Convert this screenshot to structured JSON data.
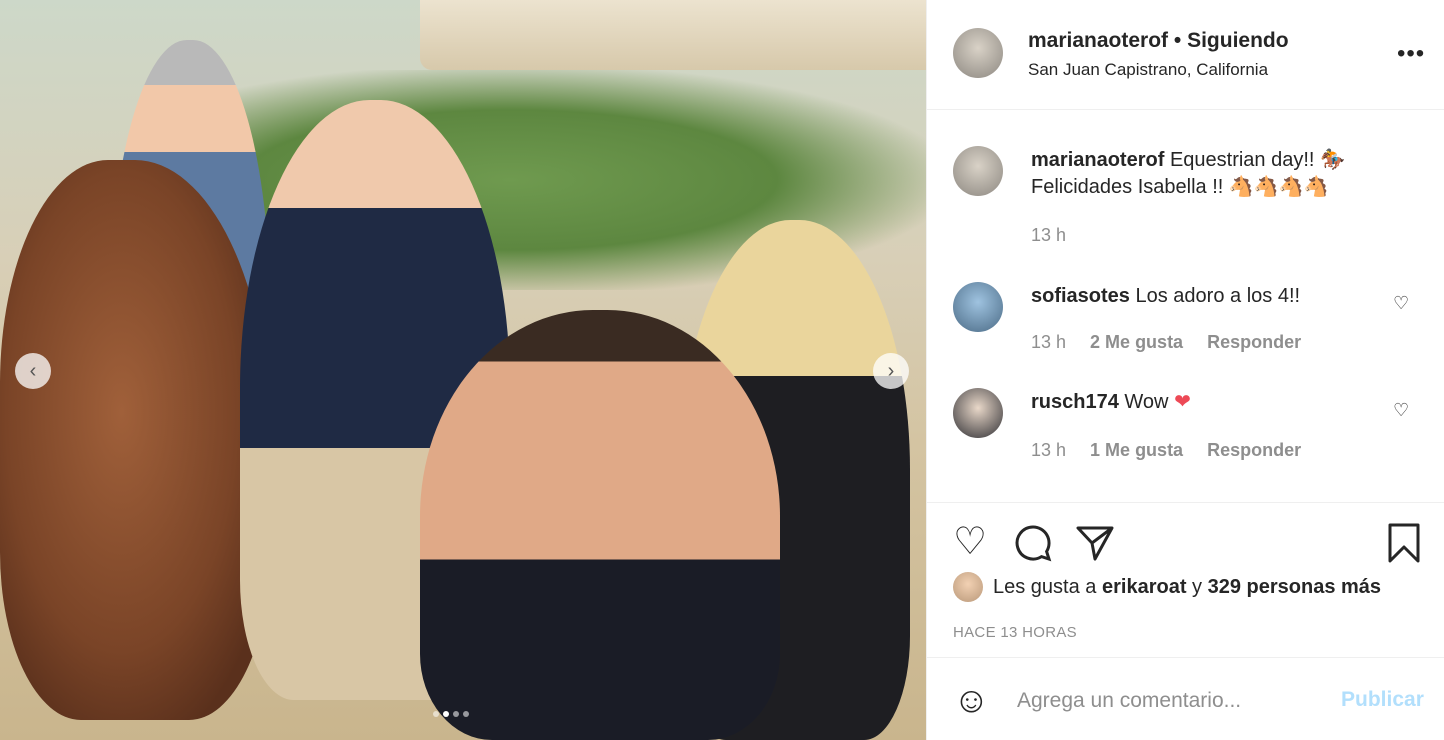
{
  "post": {
    "username": "marianaoterof",
    "separator": "•",
    "follow_status": "Siguiendo",
    "location": "San Juan Capistrano, California",
    "carousel_dots": 4,
    "active_dot": 2
  },
  "caption": {
    "username": "marianaoterof",
    "line1": "Equestrian day!! 🏇",
    "line2": "Felicidades Isabella !! 🐴🐴🐴🐴",
    "time": "13 h"
  },
  "comments": [
    {
      "username": "sofiasotes",
      "text": "Los adoro a los 4!!",
      "time": "13 h",
      "likes": "2 Me gusta",
      "reply": "Responder"
    },
    {
      "username": "rusch174",
      "text": "Wow",
      "emoji": "❤",
      "time": "13 h",
      "likes": "1 Me gusta",
      "reply": "Responder"
    }
  ],
  "likes": {
    "prefix": "Les gusta a",
    "user": "erikaroat",
    "conj": "y",
    "others": "329 personas más"
  },
  "timestamp": "HACE 13 HORAS",
  "comment_box": {
    "placeholder": "Agrega un comentario...",
    "publish": "Publicar"
  },
  "colors": {
    "publish_disabled": "#b2dffc",
    "heart": "#ed4956",
    "meta_gray": "#8e8e8e"
  }
}
